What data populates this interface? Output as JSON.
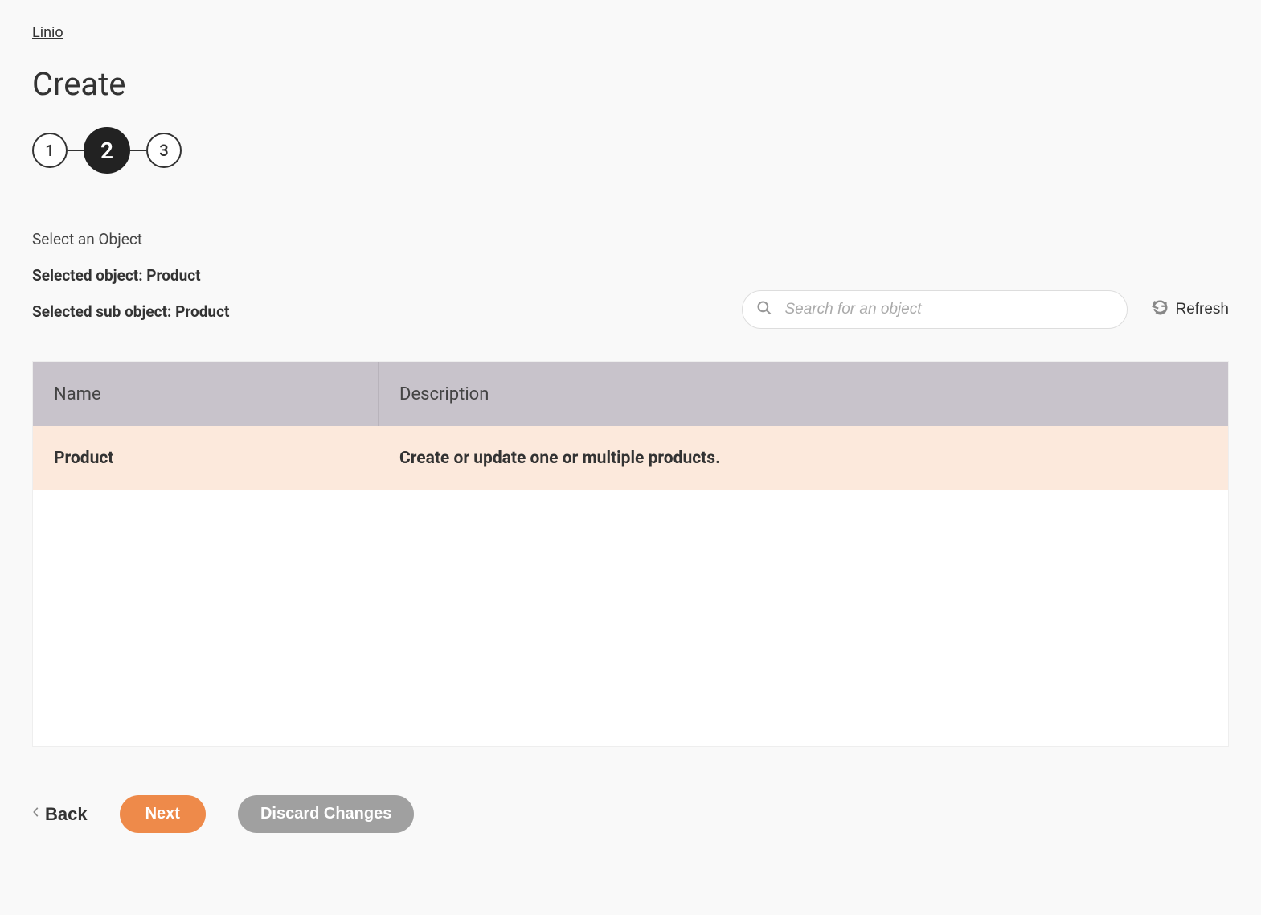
{
  "breadcrumb": {
    "label": "Linio"
  },
  "page": {
    "title": "Create"
  },
  "stepper": {
    "steps": [
      "1",
      "2",
      "3"
    ],
    "activeIndex": 1
  },
  "section": {
    "label": "Select an Object",
    "selectedObject": "Selected object: Product",
    "selectedSubObject": "Selected sub object: Product"
  },
  "search": {
    "placeholder": "Search for an object"
  },
  "refresh": {
    "label": "Refresh"
  },
  "table": {
    "headers": {
      "name": "Name",
      "description": "Description"
    },
    "rows": [
      {
        "name": "Product",
        "description": "Create or update one or multiple products.",
        "selected": true
      }
    ]
  },
  "footer": {
    "back": "Back",
    "next": "Next",
    "discard": "Discard Changes"
  }
}
